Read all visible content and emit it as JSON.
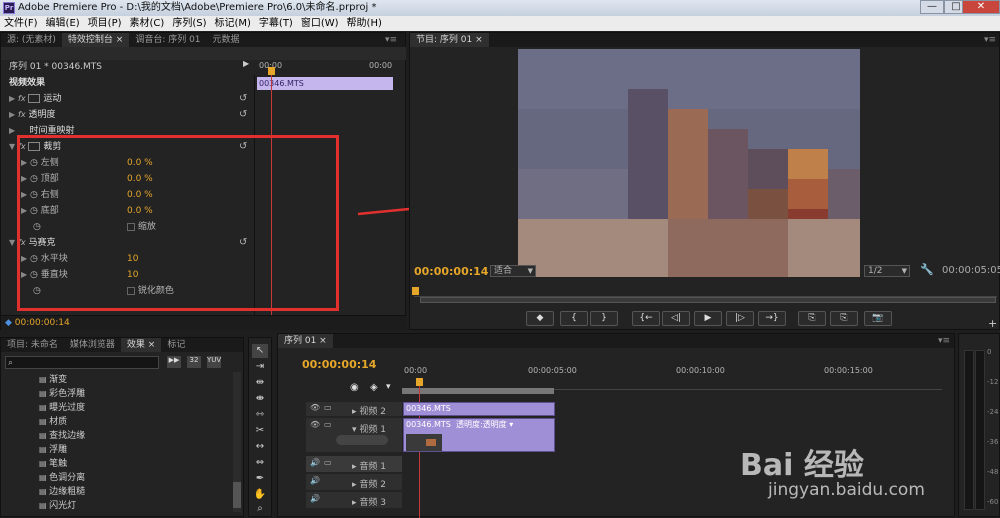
{
  "window": {
    "title": "Adobe Premiere Pro - D:\\我的文档\\Adobe\\Premiere Pro\\6.0\\未命名.prproj *",
    "app_badge": "Pr",
    "min": "—",
    "max": "□",
    "close": "✕"
  },
  "menu": [
    "文件(F)",
    "编辑(E)",
    "项目(P)",
    "素材(C)",
    "序列(S)",
    "标记(M)",
    "字幕(T)",
    "窗口(W)",
    "帮助(H)"
  ],
  "source_panel": {
    "tabs": [
      "源: (无素材)",
      "特效控制台 ×",
      "调音台: 序列 01",
      "元数据"
    ],
    "header": "序列 01 * 00346.MTS",
    "ruler_start": "00:00",
    "ruler_end": "00:00",
    "clip_name": "00346.MTS",
    "section": "视频效果",
    "effects": [
      {
        "name": "运动"
      },
      {
        "name": "透明度"
      },
      {
        "name": "时间重映射"
      },
      {
        "name": "裁剪"
      }
    ],
    "crop_params": [
      {
        "label": "左侧",
        "value": "0.0 %"
      },
      {
        "label": "顶部",
        "value": "0.0 %"
      },
      {
        "label": "右侧",
        "value": "0.0 %"
      },
      {
        "label": "底部",
        "value": "0.0 %"
      }
    ],
    "zoom_label": "缩放",
    "mosaic": {
      "name": "马赛克",
      "params": [
        {
          "label": "水平块",
          "value": "10"
        },
        {
          "label": "垂直块",
          "value": "10"
        }
      ],
      "sharpen_label": "锐化颜色"
    },
    "timecode": "00:00:00:14"
  },
  "program_panel": {
    "tab": "节目: 序列 01 ×",
    "timecode": "00:00:00:14",
    "fit": "适合",
    "resolution": "1/2",
    "duration": "00:00:05:05",
    "controls": [
      "◆",
      "{",
      "}",
      "{←",
      "◁|",
      "▶",
      "|▷",
      "→}",
      "⎘",
      "⎘",
      "📷"
    ]
  },
  "project_panel": {
    "tabs": [
      "项目: 未命名",
      "媒体浏览器",
      "效果 ×",
      "标记"
    ],
    "search_placeholder": "",
    "items": [
      "渐变",
      "彩色浮雕",
      "曝光过度",
      "材质",
      "查找边缘",
      "浮雕",
      "笔触",
      "色调分离",
      "边缘粗糙",
      "闪光灯"
    ]
  },
  "timeline": {
    "tab": "序列 01 ×",
    "timecode": "00:00:00:14",
    "ruler": [
      "00:00",
      "00:00:05:00",
      "00:00:10:00",
      "00:00:15:00"
    ],
    "tracks": [
      {
        "name": "视频 2",
        "clip": "00346.MTS"
      },
      {
        "name": "视频 1",
        "clip": "00346.MTS",
        "fx": "透明度:透明度 ▾"
      },
      {
        "name": "音频 1"
      },
      {
        "name": "音频 2"
      },
      {
        "name": "音频 3"
      }
    ]
  },
  "vu_meter": {
    "ticks": [
      "0",
      "-12",
      "-24",
      "-36",
      "-48",
      "-60"
    ]
  },
  "watermark": {
    "brand": "Bai 经验",
    "url": "jingyan.baidu.com"
  }
}
